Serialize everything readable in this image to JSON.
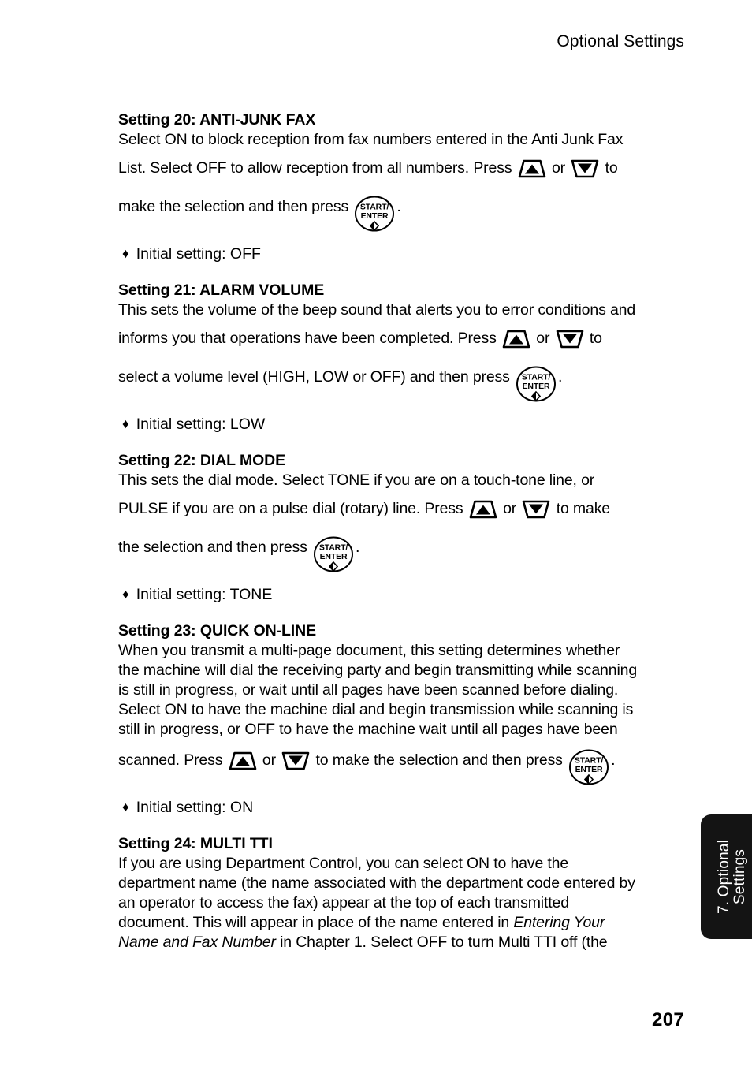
{
  "page": {
    "running_head": "Optional Settings",
    "folio": "207",
    "thumb_tab": "7. Optional\nSettings",
    "tab_color": "#141414"
  },
  "icons": {
    "up_key": "up-arrow-key-icon",
    "down_key": "down-arrow-key-icon",
    "start_enter_key": "start-enter-key-icon",
    "start_enter_top": "START/",
    "start_enter_bottom": "ENTER",
    "bullet": "♦"
  },
  "sections": [
    {
      "title": "Setting 20: ANTI-JUNK FAX",
      "lines": [
        "Select ON to block reception from fax numbers entered in the Anti Junk Fax",
        "List. Select OFF to allow reception from all numbers. Press",
        "or",
        "to",
        "make the selection and then press",
        "."
      ],
      "initial": "Initial setting: OFF"
    },
    {
      "title": "Setting 21: ALARM VOLUME",
      "lines": [
        "This sets the volume of the beep sound that alerts you to error conditions and",
        "informs you that operations have been completed. Press",
        "or",
        "to",
        "select a volume level (HIGH, LOW or OFF) and then press",
        "."
      ],
      "initial": "Initial setting: LOW"
    },
    {
      "title": "Setting 22: DIAL MODE",
      "lines": [
        "This sets the dial mode. Select TONE if you are on a touch-tone line, or",
        "PULSE if you are on a pulse dial (rotary) line. Press",
        "or",
        "to make",
        "the selection and then press",
        "."
      ],
      "initial": "Initial setting: TONE"
    },
    {
      "title": "Setting 23: QUICK ON-LINE",
      "lines": [
        "When you transmit a multi-page document, this setting determines whether",
        "the machine will dial the receiving party and begin transmitting while scanning",
        "is still in progress, or wait until all pages have been scanned before dialing.",
        "Select ON to have the machine dial and begin transmission while scanning is",
        "still in progress, or OFF to have the machine wait until all pages have been",
        "scanned. Press",
        "or",
        "to make the selection and then press",
        "."
      ],
      "initial": "Initial setting: ON"
    },
    {
      "title": "Setting 24: MULTI TTI",
      "lines": [
        "If you are using Department Control, you can select ON to have the",
        "department name (the name associated with the department code entered by",
        "an operator to access the fax) appear at the top of each transmitted",
        "document. This will appear in place of the name entered in ",
        "Entering Your",
        "Name and Fax Number",
        " in Chapter 1. Select OFF to turn Multi TTI off (the"
      ],
      "initial": null
    }
  ]
}
